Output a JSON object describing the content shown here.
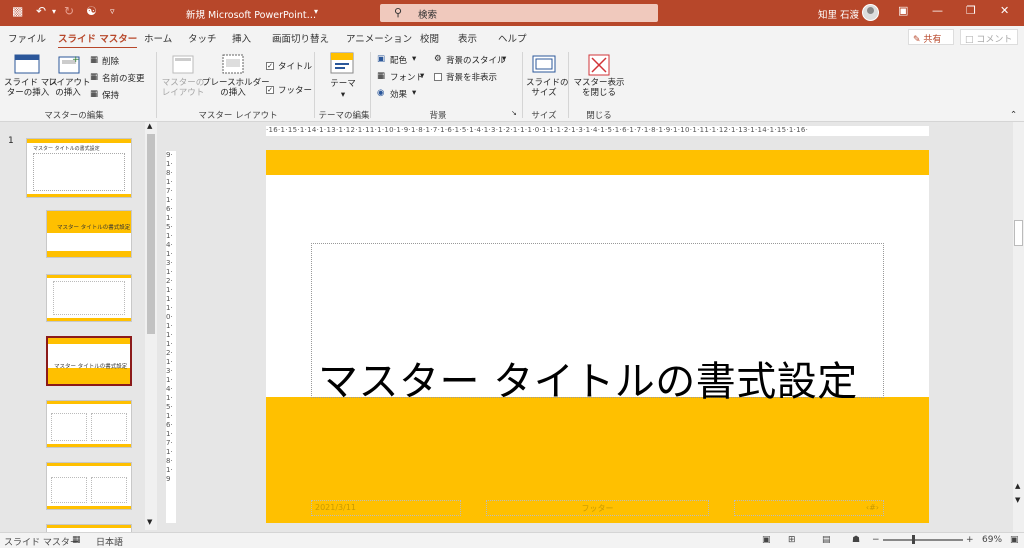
{
  "titlebar": {
    "doc_title": "新規 Microsoft PowerPoint…",
    "search_placeholder": "検索",
    "user_name": "知里 石渡"
  },
  "tabs": [
    "ファイル",
    "スライド マスター",
    "ホーム",
    "タッチ",
    "挿入",
    "画面切り替え",
    "アニメーション",
    "校閲",
    "表示",
    "ヘルプ"
  ],
  "share_label": "共有",
  "comment_label": "コメント",
  "ribbon": {
    "master_edit": {
      "insert_master": "スライド マス\nターの挿入",
      "insert_layout": "レイアウト\nの挿入",
      "delete": "削除",
      "rename": "名前の変更",
      "preserve": "保持",
      "group": "マスターの編集"
    },
    "master_layout": {
      "master_layout_btn": "マスターの\nレイアウト",
      "insert_placeholder": "プレースホルダー\nの挿入",
      "title_chk": "タイトル",
      "footer_chk": "フッター",
      "group": "マスター レイアウト"
    },
    "theme_edit": {
      "theme": "テーマ",
      "group": "テーマの編集"
    },
    "background": {
      "colors": "配色",
      "fonts": "フォント",
      "effects": "効果",
      "bg_styles": "背景のスタイル",
      "hide_bg": "背景を非表示",
      "group": "背景"
    },
    "size": {
      "slide_size": "スライドの\nサイズ",
      "group": "サイズ"
    },
    "close": {
      "close_master": "マスター表示\nを閉じる",
      "group": "閉じる"
    }
  },
  "thumbnails": {
    "slide_number": "1",
    "master_title": "マスター タイトルの書式設定",
    "title_slide_text": "マスター タイトルの書式設定"
  },
  "rulers": {
    "h_ticks": "·16·1·15·1·14·1·13·1·12·1·11·1·10·1·9·1·8·1·7·1·6·1·5·1·4·1·3·1·2·1·1·1·0·1·1·1·2·1·3·1·4·1·5·1·6·1·7·1·8·1·9·1·10·1·11·1·12·1·13·1·14·1·15·1·16·",
    "v_ticks": "9·1·8·1·7·1·6·1·5·1·4·1·3·1·2·1·1·1·0·1·1·1·2·1·3·1·4·1·5·1·6·1·7·1·8·1·9"
  },
  "slide": {
    "title": "マスター タイトルの書式設定",
    "date": "2021/3/11",
    "footer": "フッター",
    "page_num": "‹#›"
  },
  "status": {
    "view": "スライド マスター",
    "language": "日本語",
    "zoom": "69%"
  },
  "colors": {
    "accent": "#b7472a",
    "band": "#ffc000"
  }
}
